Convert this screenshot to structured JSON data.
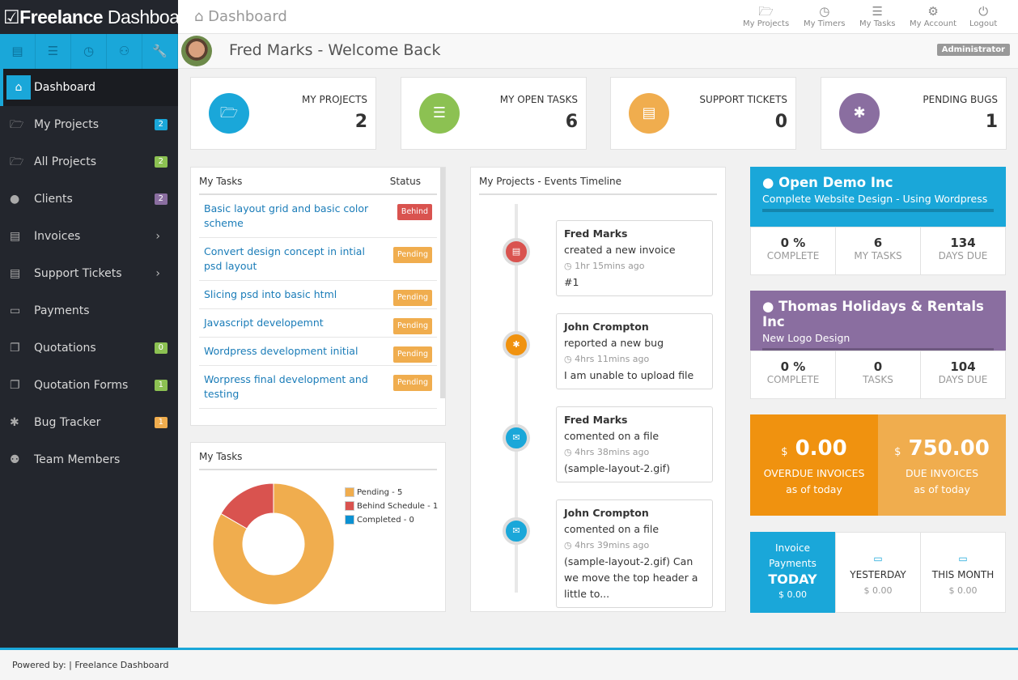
{
  "brand": {
    "bold": "Freelance",
    "light": "Dashboard",
    "icon": "check-square-icon"
  },
  "header": {
    "title": "Dashboard",
    "nav": [
      {
        "label": "My Projects",
        "icon": "folder-open-icon"
      },
      {
        "label": "My Timers",
        "icon": "clock-icon"
      },
      {
        "label": "My Tasks",
        "icon": "list-icon"
      },
      {
        "label": "My Account",
        "icon": "gears-icon"
      },
      {
        "label": "Logout",
        "icon": "power-icon"
      }
    ]
  },
  "quickbar": [
    "file-icon",
    "list-icon",
    "clock-icon",
    "sitemap-icon",
    "wrench-icon"
  ],
  "welcome": {
    "text": "Fred Marks - Welcome Back",
    "role": "Administrator"
  },
  "sidebar": {
    "items": [
      {
        "label": "Dashboard",
        "icon": "home-icon",
        "active": true
      },
      {
        "label": "My Projects",
        "icon": "folder-open-icon",
        "badge": "2",
        "badge_color": "#1aa7d9"
      },
      {
        "label": "All Projects",
        "icon": "folder-open-icon",
        "badge": "2",
        "badge_color": "#8cc152"
      },
      {
        "label": "Clients",
        "icon": "user-icon",
        "badge": "2",
        "badge_color": "#8a6ea0"
      },
      {
        "label": "Invoices",
        "icon": "list-alt-icon",
        "chevron": true
      },
      {
        "label": "Support Tickets",
        "icon": "file-icon",
        "chevron": true
      },
      {
        "label": "Payments",
        "icon": "credit-card-icon"
      },
      {
        "label": "Quotations",
        "icon": "copy-icon",
        "badge": "0",
        "badge_color": "#8cc152"
      },
      {
        "label": "Quotation Forms",
        "icon": "copy-icon",
        "badge": "1",
        "badge_color": "#8cc152"
      },
      {
        "label": "Bug Tracker",
        "icon": "bug-icon",
        "badge": "1",
        "badge_color": "#f0ad4e"
      },
      {
        "label": "Team Members",
        "icon": "users-icon"
      }
    ]
  },
  "stats": [
    {
      "label": "MY PROJECTS",
      "value": "2",
      "color": "#1aa7d9",
      "icon": "folder-open-icon"
    },
    {
      "label": "MY OPEN TASKS",
      "value": "6",
      "color": "#8cc152",
      "icon": "list-icon"
    },
    {
      "label": "SUPPORT TICKETS",
      "value": "0",
      "color": "#f0ad4e",
      "icon": "file-icon"
    },
    {
      "label": "PENDING BUGS",
      "value": "1",
      "color": "#8a6ea0",
      "icon": "bug-icon"
    }
  ],
  "tasks": {
    "title": "My Tasks",
    "status_header": "Status",
    "rows": [
      {
        "name": "Basic layout grid and basic color scheme",
        "status": "Behind",
        "color": "#d9534f"
      },
      {
        "name": "Convert design concept in intial psd layout",
        "status": "Pending",
        "color": "#f0ad4e"
      },
      {
        "name": "Slicing psd into basic html",
        "status": "Pending",
        "color": "#f0ad4e"
      },
      {
        "name": "Javascript developemnt",
        "status": "Pending",
        "color": "#f0ad4e"
      },
      {
        "name": "Wordpress development initial",
        "status": "Pending",
        "color": "#f0ad4e"
      },
      {
        "name": "Worpress final development and testing",
        "status": "Pending",
        "color": "#f0ad4e"
      }
    ]
  },
  "task_chart": {
    "title": "My Tasks",
    "legend": [
      {
        "label": "Pending - 5",
        "value": 5,
        "color": "#f0ad4e"
      },
      {
        "label": "Behind Schedule - 1",
        "value": 1,
        "color": "#d9534f"
      },
      {
        "label": "Completed - 0",
        "value": 0,
        "color": "#0b91d2"
      }
    ]
  },
  "timeline": {
    "title": "My Projects - Events Timeline",
    "events": [
      {
        "user": "Fred Marks",
        "action": "created a new invoice",
        "time": "1hr 15mins ago",
        "detail": "#1",
        "color": "#d9534f",
        "icon": "invoice-icon"
      },
      {
        "user": "John Crompton",
        "action": "reported a new bug",
        "time": "4hrs 11mins ago",
        "detail": "I am unable to upload file",
        "color": "#f0920f",
        "icon": "bug-icon"
      },
      {
        "user": "Fred Marks",
        "action": "comented on a file",
        "time": "4hrs 38mins ago",
        "detail": "(sample-layout-2.gif)",
        "color": "#1aa7d9",
        "icon": "comments-icon"
      },
      {
        "user": "John Crompton",
        "action": "comented on a file",
        "time": "4hrs 39mins ago",
        "detail": "(sample-layout-2.gif) Can we move the top header a little to...",
        "color": "#1aa7d9",
        "icon": "comments-icon"
      }
    ]
  },
  "projects": [
    {
      "client": "Open Demo Inc",
      "project": "Complete Website Design - Using Wordpress",
      "color": "#1aa7d9",
      "stats": [
        {
          "v": "0 %",
          "l": "COMPLETE"
        },
        {
          "v": "6",
          "l": "MY TASKS"
        },
        {
          "v": "134",
          "l": "DAYS DUE"
        }
      ]
    },
    {
      "client": "Thomas Holidays & Rentals Inc",
      "project": "New Logo Design",
      "color": "#8a6ea0",
      "stats": [
        {
          "v": "0 %",
          "l": "COMPLETE"
        },
        {
          "v": "0",
          "l": "TASKS"
        },
        {
          "v": "104",
          "l": "DAYS DUE"
        }
      ]
    }
  ],
  "invoices": {
    "overdue": {
      "currency": "$",
      "amount": "0.00",
      "label": "OVERDUE INVOICES",
      "sub": "as of today"
    },
    "due": {
      "currency": "$",
      "amount": "750.00",
      "label": "DUE INVOICES",
      "sub": "as of today"
    }
  },
  "payments": {
    "title1": "Invoice",
    "title2": "Payments",
    "today": "TODAY",
    "today_amount": "$ 0.00",
    "yesterday": "YESTERDAY",
    "yesterday_amount": "$ 0.00",
    "month": "THIS MONTH",
    "month_amount": "$ 0.00"
  },
  "footer": {
    "text": "Powered by: | Freelance Dashboard"
  }
}
